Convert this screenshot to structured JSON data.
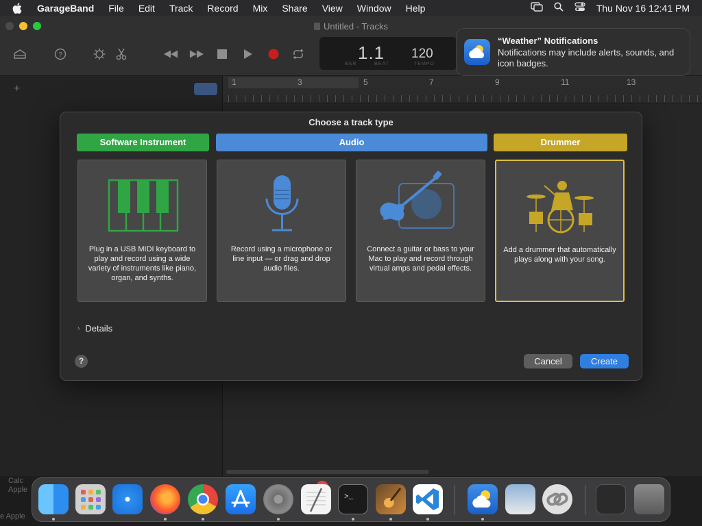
{
  "menubar": {
    "app": "GarageBand",
    "items": [
      "File",
      "Edit",
      "Track",
      "Record",
      "Mix",
      "Share",
      "View",
      "Window",
      "Help"
    ],
    "clock": "Thu Nov 16  12:41 PM"
  },
  "window": {
    "title": "Untitled - Tracks",
    "lcd": {
      "position": "1.1",
      "tempo": "120",
      "bar_label": "BAR",
      "beat_label": "BEAT",
      "tempo_label": "TEMPO"
    },
    "ruler": [
      "1",
      "3",
      "5",
      "7",
      "9",
      "11",
      "13"
    ]
  },
  "notification": {
    "title": "“Weather” Notifications",
    "body": "Notifications may include alerts, sounds, and icon badges."
  },
  "dialog": {
    "title": "Choose a track type",
    "categories": {
      "software": "Software Instrument",
      "audio": "Audio",
      "drummer": "Drummer"
    },
    "cards": [
      {
        "desc": "Plug in a USB MIDI keyboard to play and record using a wide variety of instruments like piano, organ, and synths."
      },
      {
        "desc": "Record using a microphone or line input — or drag and drop audio files."
      },
      {
        "desc": "Connect a guitar or bass to your Mac to play and record through virtual amps and pedal effects."
      },
      {
        "desc": "Add a drummer that automatically plays along with your song."
      }
    ],
    "details_label": "Details",
    "help_label": "?",
    "cancel_label": "Cancel",
    "create_label": "Create"
  },
  "dock": {
    "badge": "1",
    "left_text": [
      "Calc",
      "Apple",
      "e Apple"
    ]
  },
  "colors": {
    "software": "#2fa544",
    "audio": "#4a8ad6",
    "drummer": "#c6a626",
    "primary": "#2f7fe0"
  }
}
